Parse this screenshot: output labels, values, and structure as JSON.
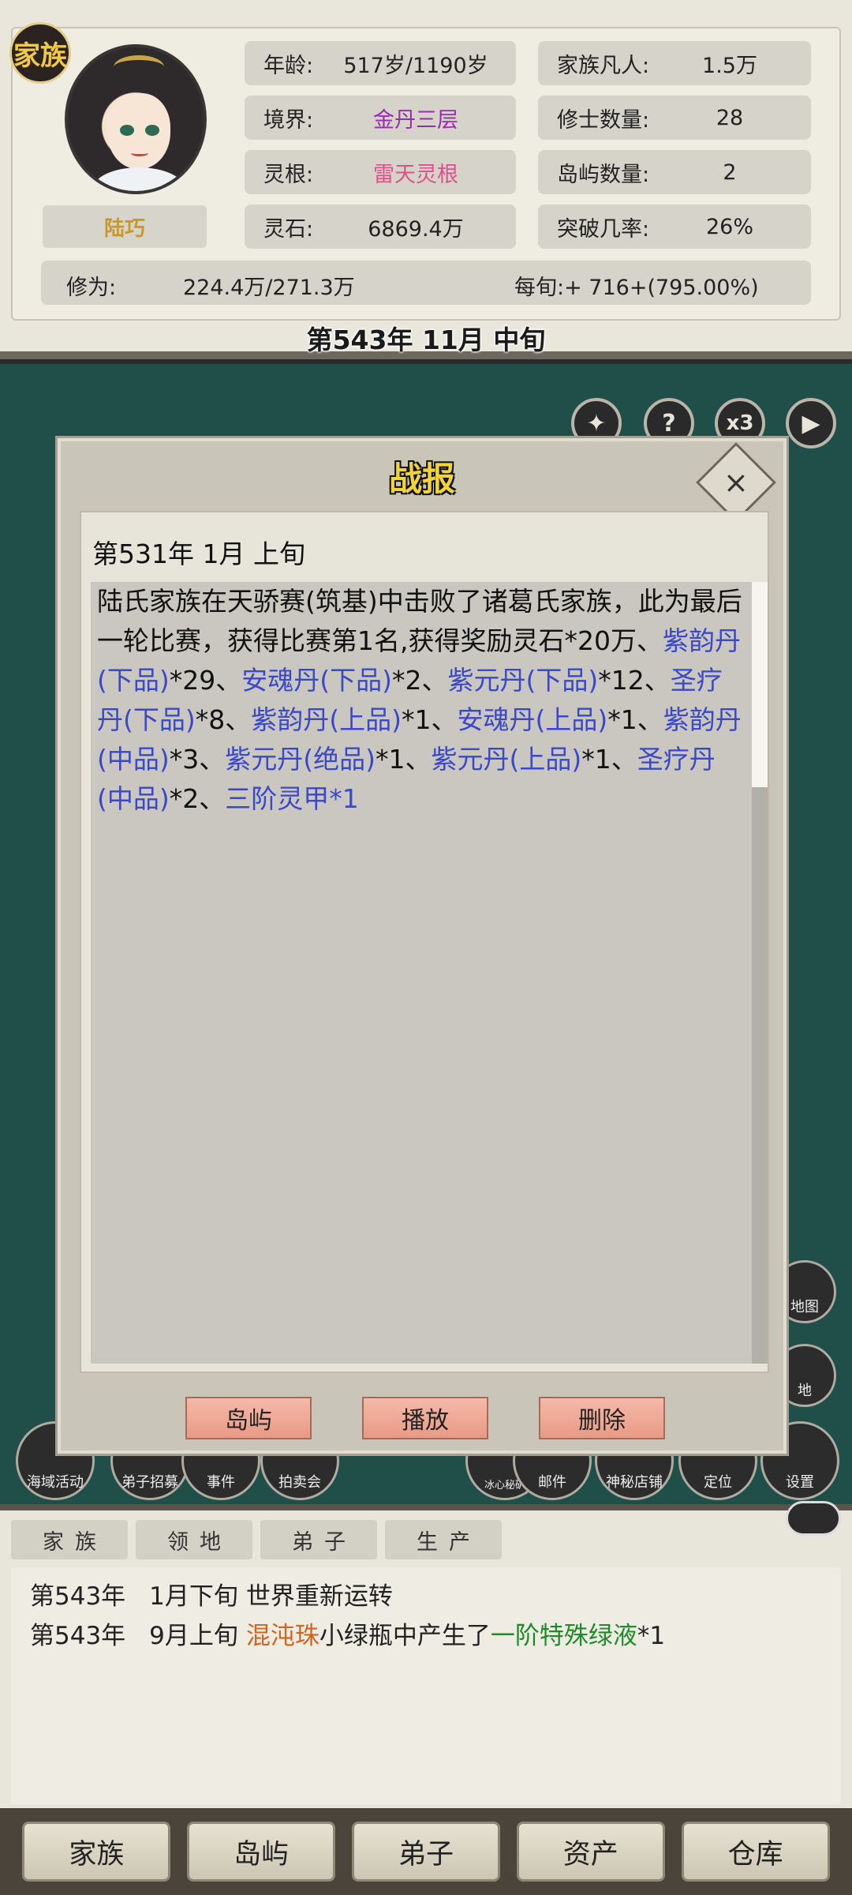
{
  "header": {
    "clan_badge": "家族",
    "character_name": "陆巧",
    "stats": {
      "age_label": "年龄:",
      "age_value": "517岁/1190岁",
      "realm_label": "境界:",
      "realm_value": "金丹三层",
      "root_label": "灵根:",
      "root_value": "雷天灵根",
      "stones_label": "灵石:",
      "stones_value": "6869.4万",
      "mortals_label": "家族凡人:",
      "mortals_value": "1.5万",
      "cultivators_label": "修士数量:",
      "cultivators_value": "28",
      "islands_label": "岛屿数量:",
      "islands_value": "2",
      "breakthrough_label": "突破几率:",
      "breakthrough_value": "26%",
      "cultivation_label": "修为:",
      "cultivation_value": "224.4万/271.3万",
      "per_period": "每旬:+ 716+(795.00%)"
    },
    "date": "第543年 11月 中旬",
    "colors": {
      "realm": "#9b2ab0",
      "root": "#e0508a",
      "name": "#c9982a"
    }
  },
  "controls": {
    "help_icon": "?",
    "speed_label": "x3",
    "play_icon": "play-icon"
  },
  "modal": {
    "title": "战报",
    "close_icon": "×",
    "report_date": "第531年 1月 上旬",
    "report": {
      "intro": "陆氏家族在天骄赛(筑基)中击败了诸葛氏家族，此为最后一轮比赛，获得比赛第1名,获得奖励灵石*20万、",
      "rewards": [
        {
          "name": "紫韵丹(下品)",
          "count": "*29"
        },
        {
          "name": "安魂丹(下品)",
          "count": "*2"
        },
        {
          "name": "紫元丹(下品)",
          "count": "*12"
        },
        {
          "name": "圣疗丹(下品)",
          "count": "*8"
        },
        {
          "name": "紫韵丹(上品)",
          "count": "*1"
        },
        {
          "name": "安魂丹(上品)",
          "count": "*1"
        },
        {
          "name": "紫韵丹(中品)",
          "count": "*3"
        },
        {
          "name": "紫元丹(绝品)",
          "count": "*1"
        },
        {
          "name": "紫元丹(上品)",
          "count": "*1"
        },
        {
          "name": "圣疗丹(中品)",
          "count": "*2"
        },
        {
          "name": "三阶灵甲*1",
          "count": ""
        }
      ],
      "separator": "、"
    },
    "buttons": {
      "island": "岛屿",
      "play": "播放",
      "delete": "删除"
    }
  },
  "features": {
    "sea_activity": "海域活动",
    "recruit": "弟子招募",
    "events": "事件",
    "auction": "拍卖会",
    "mine": "冰心秘矿",
    "mail": "邮件",
    "shop": "神秘店铺",
    "locate": "定位",
    "settings": "设置",
    "map": "地图",
    "land": "地"
  },
  "log": {
    "tabs": [
      "家族",
      "领地",
      "弟子",
      "生产"
    ],
    "entries": [
      {
        "year": "第543年",
        "period": "1月下旬",
        "parts": [
          {
            "text": "世界重新运转",
            "color": ""
          }
        ]
      },
      {
        "year": "第543年",
        "period": "9月上旬",
        "parts": [
          {
            "text": "混沌珠",
            "color": "#d0651f"
          },
          {
            "text": "小绿瓶中产生了",
            "color": ""
          },
          {
            "text": "一阶特殊绿液",
            "color": "#1f8a2a"
          },
          {
            "text": "*1",
            "color": ""
          }
        ]
      }
    ]
  },
  "nav": [
    "家族",
    "岛屿",
    "弟子",
    "资产",
    "仓库"
  ]
}
